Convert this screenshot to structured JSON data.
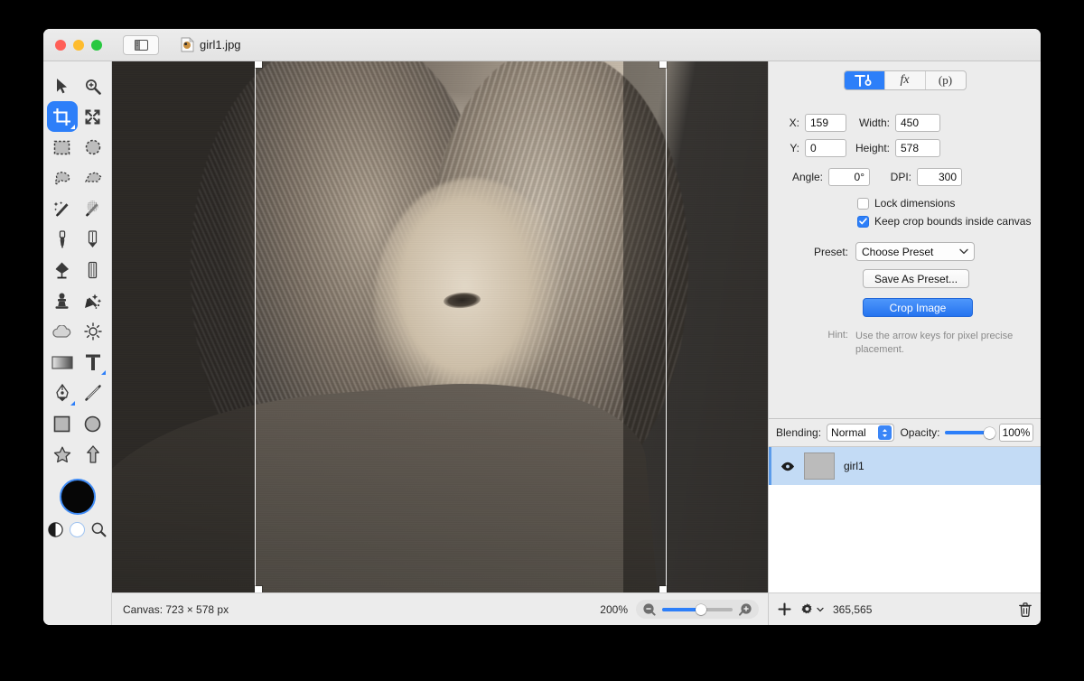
{
  "window": {
    "document_title": "girl1.jpg",
    "traffic_lights": [
      "close",
      "minimize",
      "zoom"
    ],
    "sidebar_toggle_icon": "sidebar-toggle-icon",
    "document_icon": "image-file-icon"
  },
  "tools": {
    "items": [
      {
        "name": "move-tool",
        "icon": "arrow-cursor-icon",
        "active": false,
        "has_corner": false
      },
      {
        "name": "zoom-tool",
        "icon": "magnifier-plus-icon",
        "active": false,
        "has_corner": false
      },
      {
        "name": "crop-tool",
        "icon": "crop-icon",
        "active": true,
        "has_corner": true
      },
      {
        "name": "transform-tool",
        "icon": "move-arrows-icon",
        "active": false,
        "has_corner": false
      },
      {
        "name": "rectangular-select",
        "icon": "marquee-rect-icon",
        "active": false,
        "has_corner": false
      },
      {
        "name": "elliptical-select",
        "icon": "marquee-ellipse-icon",
        "active": false,
        "has_corner": false
      },
      {
        "name": "lasso-select",
        "icon": "lasso-icon",
        "active": false,
        "has_corner": false
      },
      {
        "name": "polygon-select",
        "icon": "polygon-lasso-icon",
        "active": false,
        "has_corner": false
      },
      {
        "name": "magic-wand",
        "icon": "magic-wand-icon",
        "active": false,
        "has_corner": false
      },
      {
        "name": "dither-wand",
        "icon": "dither-wand-icon",
        "active": false,
        "has_corner": false
      },
      {
        "name": "paintbrush-tool",
        "icon": "paintbrush-icon",
        "active": false,
        "has_corner": false
      },
      {
        "name": "pencil-tool",
        "icon": "pencil-icon",
        "active": false,
        "has_corner": false
      },
      {
        "name": "paint-bucket-tool",
        "icon": "paint-bucket-icon",
        "active": false,
        "has_corner": false
      },
      {
        "name": "eraser-tool",
        "icon": "eraser-icon",
        "active": false,
        "has_corner": false
      },
      {
        "name": "clone-stamp-tool",
        "icon": "clone-stamp-icon",
        "active": false,
        "has_corner": false
      },
      {
        "name": "smudge-tool",
        "icon": "smudge-icon",
        "active": false,
        "has_corner": false
      },
      {
        "name": "blur-tool",
        "icon": "cloud-icon",
        "active": false,
        "has_corner": false
      },
      {
        "name": "brightness-tool",
        "icon": "sun-icon",
        "active": false,
        "has_corner": false
      },
      {
        "name": "gradient-tool",
        "icon": "gradient-icon",
        "active": false,
        "has_corner": false
      },
      {
        "name": "text-tool",
        "icon": "text-t-icon",
        "active": false,
        "has_corner": true
      },
      {
        "name": "pen-tool",
        "icon": "pen-nib-icon",
        "active": false,
        "has_corner": true
      },
      {
        "name": "line-tool",
        "icon": "line-icon",
        "active": false,
        "has_corner": false
      },
      {
        "name": "rectangle-shape-tool",
        "icon": "square-icon",
        "active": false,
        "has_corner": false
      },
      {
        "name": "ellipse-shape-tool",
        "icon": "circle-icon",
        "active": false,
        "has_corner": false
      },
      {
        "name": "star-shape-tool",
        "icon": "star-icon",
        "active": false,
        "has_corner": false
      },
      {
        "name": "arrow-shape-tool",
        "icon": "up-arrow-icon",
        "active": false,
        "has_corner": false
      }
    ],
    "foreground_color": "#060606",
    "background_color": "#ffffff",
    "contrast_icon": "contrast-icon",
    "loupe_icon": "loupe-icon"
  },
  "inspector": {
    "tabs": [
      {
        "label": "",
        "icon": "tool-options-icon",
        "active": true
      },
      {
        "label": "fx",
        "icon": "effects-icon",
        "active": false
      },
      {
        "label": "(p)",
        "icon": "presets-icon",
        "active": false
      }
    ],
    "fields": {
      "x_label": "X:",
      "x_value": "159",
      "width_label": "Width:",
      "width_value": "450",
      "y_label": "Y:",
      "y_value": "0",
      "height_label": "Height:",
      "height_value": "578",
      "angle_label": "Angle:",
      "angle_value": "0°",
      "dpi_label": "DPI:",
      "dpi_value": "300"
    },
    "checkboxes": [
      {
        "label": "Lock dimensions",
        "checked": false
      },
      {
        "label": "Keep crop bounds inside canvas",
        "checked": true
      }
    ],
    "preset_label": "Preset:",
    "preset_value": "Choose Preset",
    "save_preset_label": "Save As Preset...",
    "crop_button_label": "Crop Image",
    "hint_label": "Hint:",
    "hint_text": "Use the arrow keys for pixel precise placement.",
    "accent_color": "#2d7ff9"
  },
  "layers": {
    "blending_label": "Blending:",
    "blending_value": "Normal",
    "opacity_label": "Opacity:",
    "opacity_value": "100%",
    "opacity_percent": 100,
    "rows": [
      {
        "name": "girl1",
        "visible": true,
        "selected": true,
        "visibility_icon": "eye-icon"
      }
    ],
    "footer": {
      "add_icon": "plus-icon",
      "settings_icon": "gear-icon",
      "count": "365,565",
      "delete_icon": "trash-icon"
    }
  },
  "statusbar": {
    "canvas_label": "Canvas: 723 × 578 px",
    "zoom_level": "200%",
    "zoom_percent": 55,
    "zoom_out_icon": "zoom-out-icon",
    "zoom_in_icon": "zoom-in-icon"
  },
  "canvas": {
    "crop_overlay_name": "crop-selection",
    "crop_handles": [
      "top-left",
      "top-right",
      "bottom-left",
      "bottom-right"
    ],
    "image_name": "girl1.jpg"
  }
}
